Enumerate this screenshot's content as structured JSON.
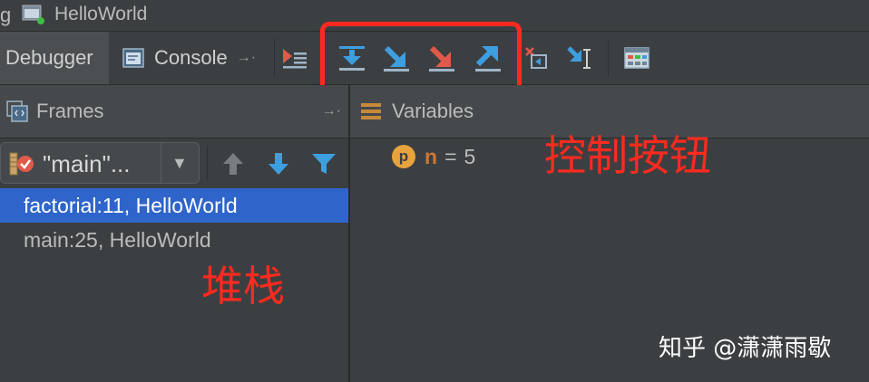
{
  "window": {
    "title_cut": "g",
    "title": "HelloWorld"
  },
  "toolbar": {
    "tabs": [
      {
        "label": "Debugger"
      },
      {
        "label": "Console"
      }
    ],
    "pin_glyph": "→·",
    "buttons": [
      {
        "icon": "show-execution-point-icon"
      },
      {
        "icon": "step-over-icon"
      },
      {
        "icon": "step-into-icon"
      },
      {
        "icon": "force-step-into-icon"
      },
      {
        "icon": "step-out-icon"
      },
      {
        "icon": "drop-frame-icon"
      },
      {
        "icon": "run-to-cursor-icon"
      },
      {
        "icon": "evaluate-expression-icon"
      }
    ]
  },
  "frames_panel": {
    "title": "Frames",
    "thread_selected": "\"main\"...",
    "items": [
      {
        "label": "factorial:11, HelloWorld",
        "selected": true
      },
      {
        "label": "main:25, HelloWorld",
        "selected": false
      }
    ]
  },
  "variables_panel": {
    "title": "Variables",
    "variables": [
      {
        "badge": "p",
        "name": "n",
        "eq": "=",
        "value": "5"
      }
    ]
  },
  "annotations": {
    "controls": "控制按钮",
    "stack": "堆栈",
    "watermark": "知乎 @潇潇雨歇"
  },
  "colors": {
    "highlight": "#ff2a1f",
    "selection": "#2f65ca",
    "step_blue": "#3d9ee0",
    "step_red": "#e05a4a"
  }
}
